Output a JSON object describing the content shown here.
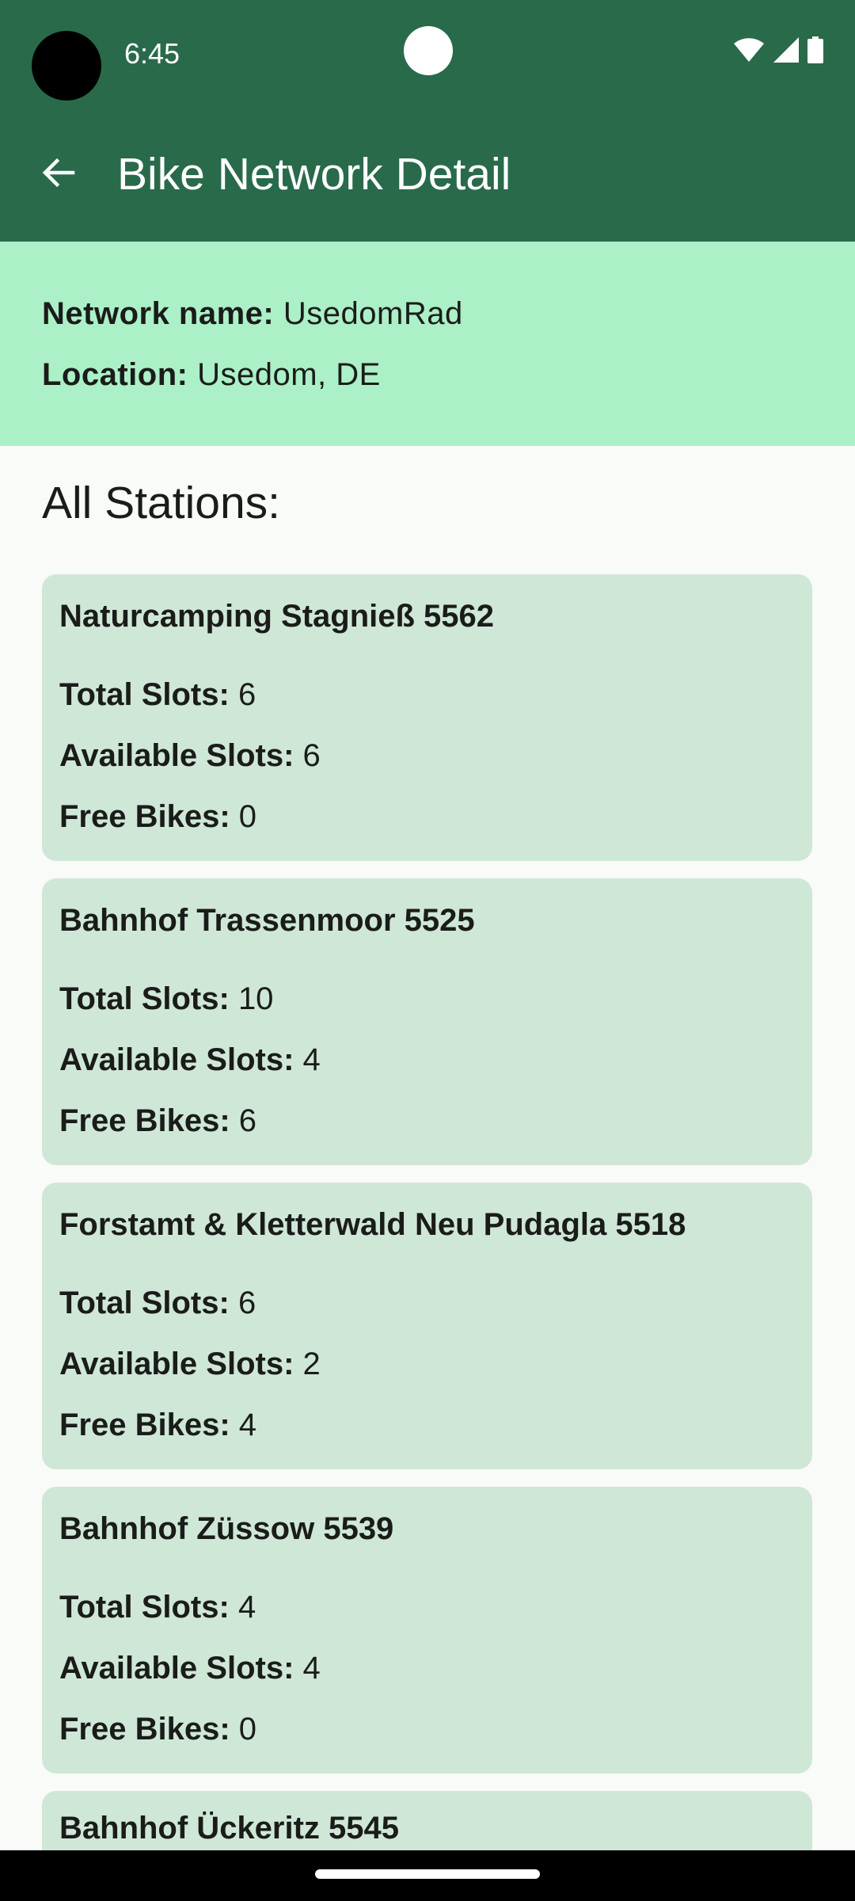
{
  "status_bar": {
    "time": "6:45",
    "icons": [
      "wifi-icon",
      "cellular-signal-icon",
      "battery-icon"
    ]
  },
  "app_bar": {
    "back_icon": "arrow-left-icon",
    "title": "Bike Network Detail"
  },
  "network": {
    "name_label": "Network name:",
    "name_value": "UsedomRad",
    "location_label": "Location:",
    "location_value": "Usedom, DE"
  },
  "stations_section": {
    "title": "All Stations:"
  },
  "field_labels": {
    "total_slots": "Total Slots:",
    "available_slots": "Available Slots:",
    "free_bikes": "Free Bikes:"
  },
  "stations": [
    {
      "name": "Naturcamping Stagnieß 5562",
      "total_slots": "6",
      "available_slots": "6",
      "free_bikes": "0"
    },
    {
      "name": "Bahnhof Trassenmoor 5525",
      "total_slots": "10",
      "available_slots": "4",
      "free_bikes": "6"
    },
    {
      "name": "Forstamt & Kletterwald Neu Pudagla 5518",
      "total_slots": "6",
      "available_slots": "2",
      "free_bikes": "4"
    },
    {
      "name": "Bahnhof Züssow 5539",
      "total_slots": "4",
      "available_slots": "4",
      "free_bikes": "0"
    },
    {
      "name": "Bahnhof Ückeritz 5545"
    }
  ],
  "colors": {
    "primary": "#296a4b",
    "header_container": "#abf0c7",
    "card_background": "#cfe7d7",
    "page_background": "#f8fbf7"
  }
}
